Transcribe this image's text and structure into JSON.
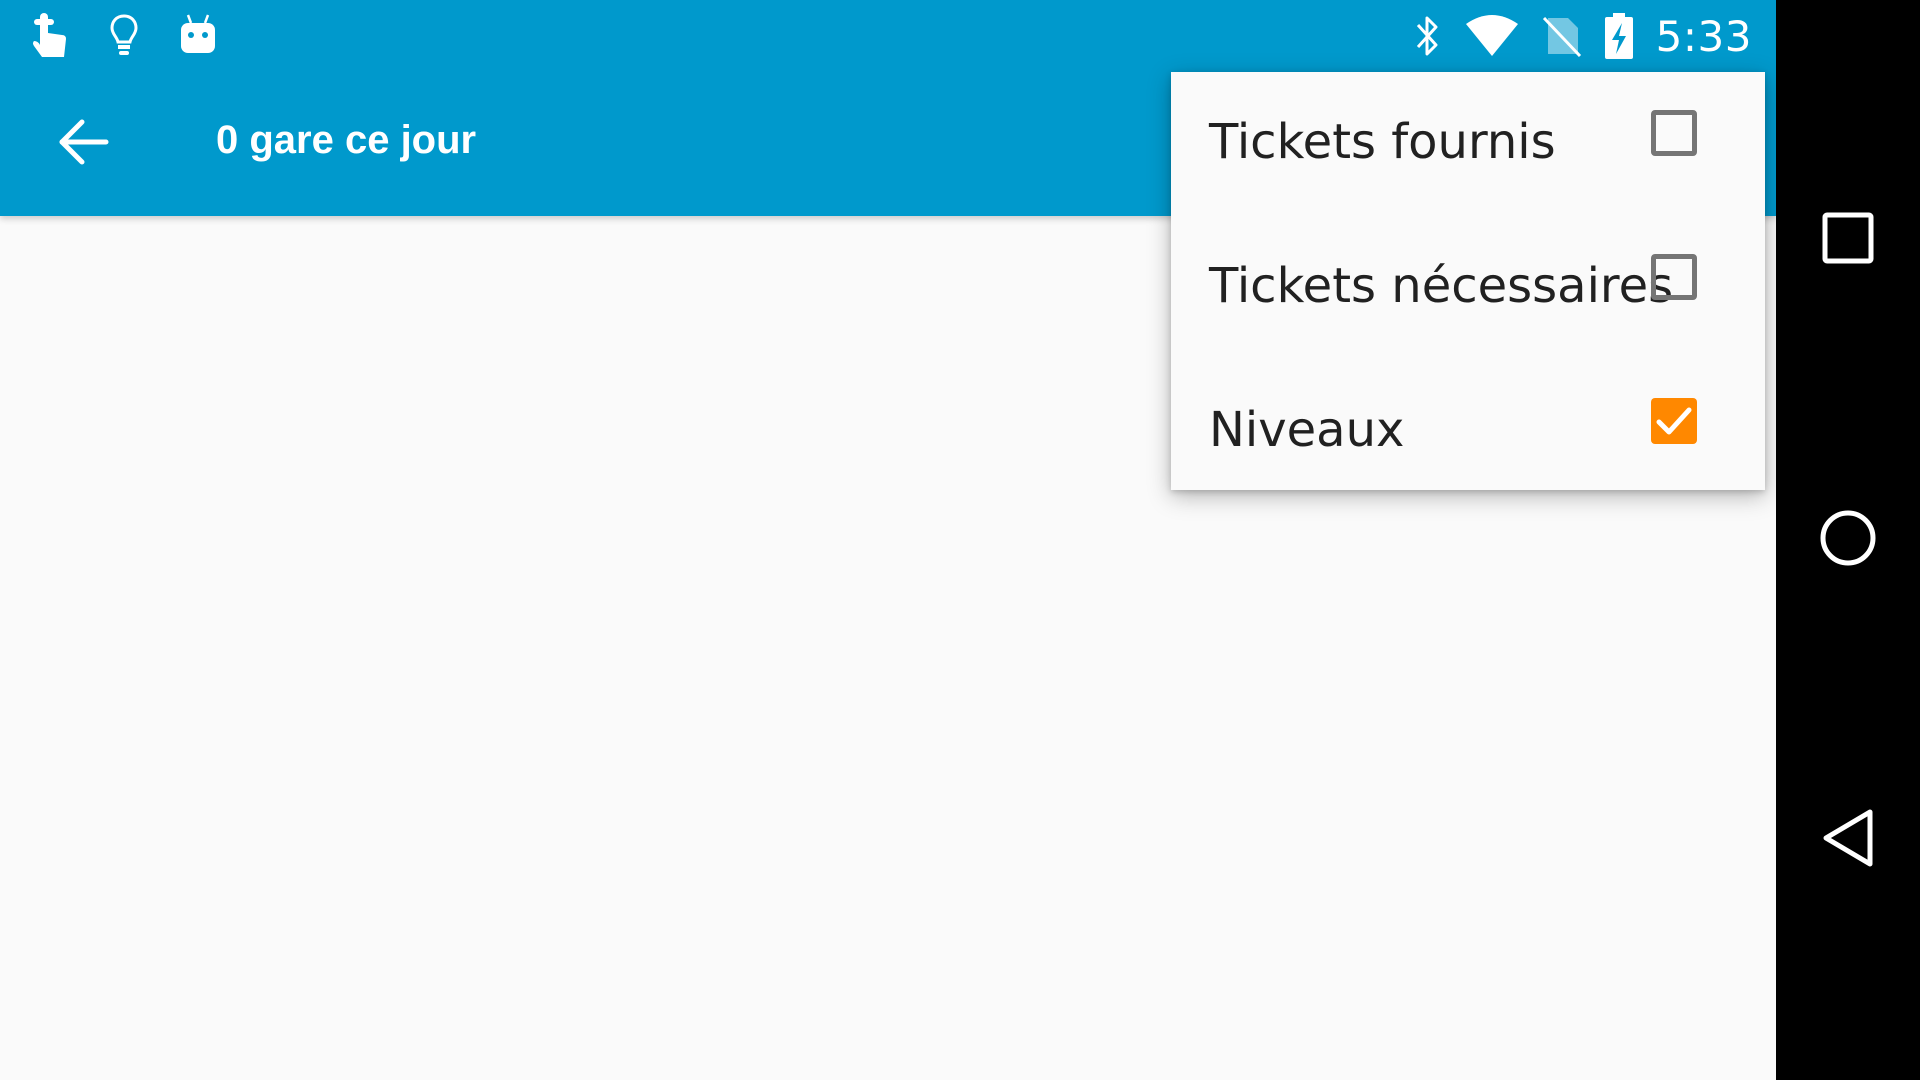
{
  "status_bar": {
    "left_icons": [
      "touch-hand-icon",
      "lightbulb-icon",
      "android-robot-icon"
    ],
    "right_icons": [
      "bluetooth-icon",
      "wifi-icon",
      "no-sim-icon",
      "battery-charging-icon"
    ],
    "time": "5:33"
  },
  "app_bar": {
    "back_icon": "arrow-back-icon",
    "title": "0 gare ce jour",
    "color": "#0099cc"
  },
  "overflow_menu": {
    "items": [
      {
        "label": "Tickets fournis",
        "checked": false
      },
      {
        "label": "Tickets nécessaires",
        "checked": false
      },
      {
        "label": "Niveaux",
        "checked": true
      }
    ],
    "check_color": "#ff8800"
  },
  "nav_bar": {
    "buttons": [
      "recents-square-icon",
      "home-circle-icon",
      "back-triangle-icon"
    ]
  }
}
